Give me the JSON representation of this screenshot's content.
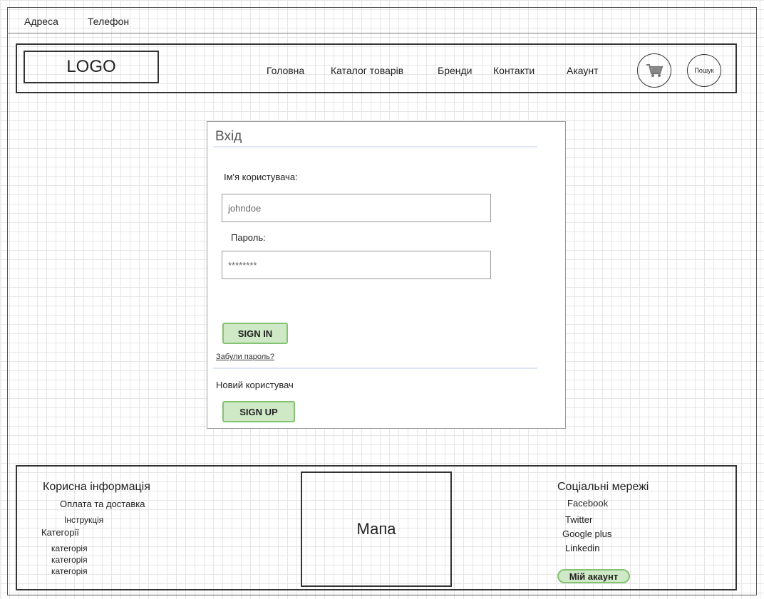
{
  "topbar": {
    "address": "Адреса",
    "phone": "Телефон"
  },
  "header": {
    "logo": "LOGO",
    "nav": [
      "Головна",
      "Каталог товарів",
      "Бренди",
      "Контакти",
      "Акаунт"
    ],
    "cart_icon": "cart-icon",
    "search_label": "Пошук"
  },
  "login": {
    "title": "Вхід",
    "username_label": "Ім'я користувача:",
    "username_value": "johndoe",
    "password_label": "Пароль:",
    "password_value": "********",
    "sign_in": "SIGN IN",
    "forgot": "Забули пароль?",
    "new_user": "Новий користувач",
    "sign_up": "SIGN UP"
  },
  "footer": {
    "useful_title": "Корисна інформація",
    "useful_items": [
      "Оплата та доставка",
      "Інструкція"
    ],
    "categories_title": "Категорії",
    "categories": [
      "категорія",
      "категорія",
      "категорія"
    ],
    "map": "Мапа",
    "social_title": "Соціальні мережі",
    "social": [
      "Facebook",
      "Twitter",
      "Google plus",
      "Linkedin"
    ],
    "my_account": "Мій акаунт"
  },
  "colors": {
    "button_bg": "#cfe8c6",
    "button_border": "#84c274"
  }
}
